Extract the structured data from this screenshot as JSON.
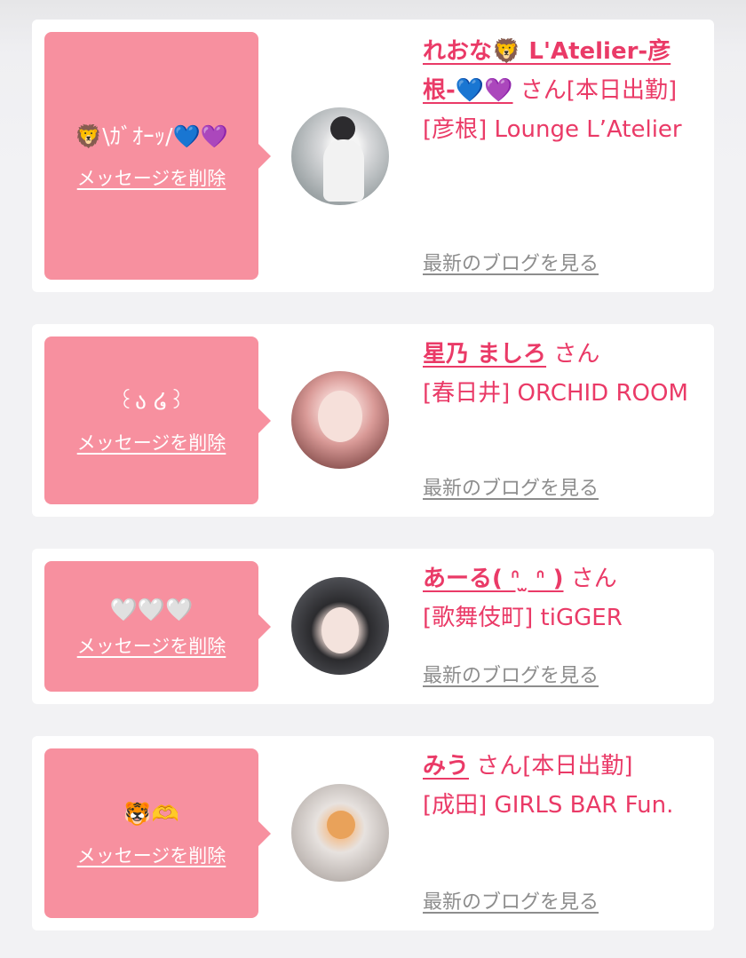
{
  "entries": [
    {
      "message": "🦁\\ｶﾞｵｰｯ/💙💜",
      "delete_label": "メッセージを削除",
      "name": "れおな🦁 L'Atelier-彦根-💙💜",
      "suffix": " さん[本日出勤]",
      "store": "[彦根] Lounge L’Atelier",
      "blog_label": "最新のブログを見る",
      "avatar_icon": "profile-photo"
    },
    {
      "message": "꒰ა ໒꒱",
      "delete_label": "メッセージを削除",
      "name": "星乃 ましろ",
      "suffix": " さん",
      "store": "[春日井] ORCHID ROOM",
      "blog_label": "最新のブログを見る",
      "avatar_icon": "profile-photo"
    },
    {
      "message": "🤍🤍🤍",
      "delete_label": "メッセージを削除",
      "name": "あーる( ᐢ ̫ ᐢ )",
      "suffix": " さん",
      "store": "[歌舞伎町] tiGGER",
      "blog_label": "最新のブログを見る",
      "avatar_icon": "profile-photo"
    },
    {
      "message": "🐯🫶",
      "delete_label": "メッセージを削除",
      "name": "みう",
      "suffix": " さん[本日出勤]",
      "store": "[成田] GIRLS BAR Fun.",
      "blog_label": "最新のブログを見る",
      "avatar_icon": "profile-photo"
    }
  ],
  "colors": {
    "bubble": "#f7909f",
    "accent": "#ea3a67",
    "muted_link": "#8d8d8d"
  }
}
